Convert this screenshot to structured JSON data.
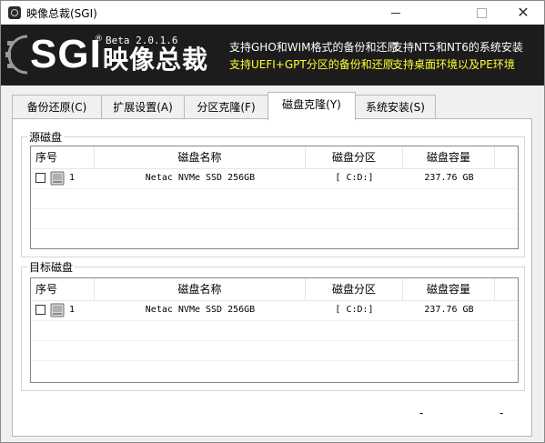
{
  "window": {
    "title": "映像总裁(SGI)",
    "controls": {
      "minimize": "minimize",
      "maximize": "maximize",
      "close": "✕"
    }
  },
  "banner": {
    "logo": "SGI",
    "registered": "®",
    "version": "Beta 2.0.1.6",
    "name": "映像总裁",
    "features": [
      "支持GHO和WIM格式的备份和还原",
      "支持NT5和NT6的系统安装",
      "支持UEFI+GPT分区的备份和还原",
      "支持桌面环境以及PE环境"
    ],
    "colors": {
      "background": "#1c1c1c",
      "white_text": "#ffffff",
      "highlight_text": "#ffff33"
    }
  },
  "tabs": [
    {
      "label": "备份还原(C)",
      "active": false
    },
    {
      "label": "扩展设置(A)",
      "active": false
    },
    {
      "label": "分区克隆(F)",
      "active": false
    },
    {
      "label": "磁盘克隆(Y)",
      "active": true
    },
    {
      "label": "系统安装(S)",
      "active": false
    }
  ],
  "source_disk": {
    "group_title": "源磁盘",
    "columns": [
      "序号",
      "磁盘名称",
      "磁盘分区",
      "磁盘容量"
    ],
    "rows": [
      {
        "checked": false,
        "index": "1",
        "name": "Netac NVMe SSD 256GB",
        "partitions": "[ C:D:]",
        "capacity": "237.76 GB"
      }
    ]
  },
  "target_disk": {
    "group_title": "目标磁盘",
    "columns": [
      "序号",
      "磁盘名称",
      "磁盘分区",
      "磁盘容量"
    ],
    "rows": [
      {
        "checked": false,
        "index": "1",
        "name": "Netac NVMe SSD 256GB",
        "partitions": "[ C:D:]",
        "capacity": "237.76 GB"
      }
    ]
  },
  "status": [
    "-",
    "-"
  ]
}
